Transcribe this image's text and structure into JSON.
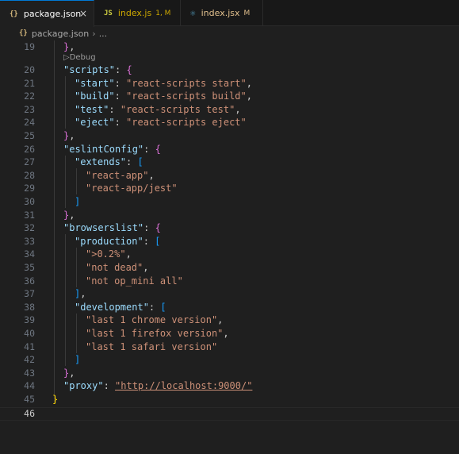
{
  "tabs": [
    {
      "icon": "{}",
      "label": "package.json",
      "badge": "",
      "active": true
    },
    {
      "icon": "JS",
      "label": "index.js",
      "badge": "1, M",
      "active": false
    },
    {
      "icon": "⚛",
      "label": "index.jsx",
      "badge": "M",
      "active": false
    }
  ],
  "close_glyph": "×",
  "breadcrumb": {
    "icon": "{}",
    "file": "package.json",
    "sep": "›",
    "more": "..."
  },
  "codelens": "▷Debug",
  "colors": {
    "accent": "#0078d4",
    "key": "#9cdcfe",
    "string": "#ce9178",
    "bracket1": "#ffd700",
    "bracket2": "#da70d6",
    "bracket3": "#179fff"
  },
  "lines": [
    {
      "num": "19",
      "text": "},"
    },
    {
      "num": "20",
      "text": "\"scripts\": {"
    },
    {
      "num": "21",
      "text": "\"start\": \"react-scripts start\","
    },
    {
      "num": "22",
      "text": "\"build\": \"react-scripts build\","
    },
    {
      "num": "23",
      "text": "\"test\": \"react-scripts test\","
    },
    {
      "num": "24",
      "text": "\"eject\": \"react-scripts eject\""
    },
    {
      "num": "25",
      "text": "},"
    },
    {
      "num": "26",
      "text": "\"eslintConfig\": {"
    },
    {
      "num": "27",
      "text": "\"extends\": ["
    },
    {
      "num": "28",
      "text": "\"react-app\","
    },
    {
      "num": "29",
      "text": "\"react-app/jest\""
    },
    {
      "num": "30",
      "text": "]"
    },
    {
      "num": "31",
      "text": "},"
    },
    {
      "num": "32",
      "text": "\"browserslist\": {"
    },
    {
      "num": "33",
      "text": "\"production\": ["
    },
    {
      "num": "34",
      "text": "\">0.2%\","
    },
    {
      "num": "35",
      "text": "\"not dead\","
    },
    {
      "num": "36",
      "text": "\"not op_mini all\""
    },
    {
      "num": "37",
      "text": "],"
    },
    {
      "num": "38",
      "text": "\"development\": ["
    },
    {
      "num": "39",
      "text": "\"last 1 chrome version\","
    },
    {
      "num": "40",
      "text": "\"last 1 firefox version\","
    },
    {
      "num": "41",
      "text": "\"last 1 safari version\""
    },
    {
      "num": "42",
      "text": "]"
    },
    {
      "num": "43",
      "text": "},"
    },
    {
      "num": "44",
      "text": "\"proxy\": \"http://localhost:9000/\""
    },
    {
      "num": "45",
      "text": "}"
    },
    {
      "num": "46",
      "text": ""
    }
  ]
}
